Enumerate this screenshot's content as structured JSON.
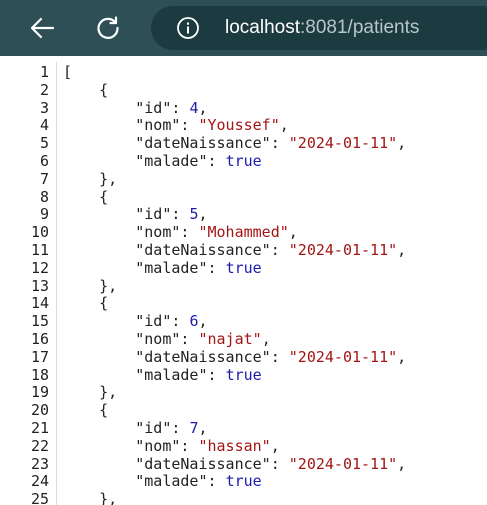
{
  "browser": {
    "back_icon": "arrow-left-icon",
    "reload_icon": "reload-icon",
    "info_icon": "info-icon",
    "url_host": "localhost",
    "url_rest": ":8081/patients"
  },
  "json_viewer": {
    "line_numbers": [
      "1",
      "2",
      "3",
      "4",
      "5",
      "6",
      "7",
      "8",
      "9",
      "10",
      "11",
      "12",
      "13",
      "14",
      "15",
      "16",
      "17",
      "18",
      "19",
      "20",
      "21",
      "22",
      "23",
      "24",
      "25"
    ],
    "open_bracket": "[",
    "open_brace": "{",
    "close_brace_comma": "},",
    "patients": [
      {
        "id": "4",
        "nom": "\"Youssef\"",
        "dateNaissance": "\"2024-01-11\"",
        "malade": "true"
      },
      {
        "id": "5",
        "nom": "\"Mohammed\"",
        "dateNaissance": "\"2024-01-11\"",
        "malade": "true"
      },
      {
        "id": "6",
        "nom": "\"najat\"",
        "dateNaissance": "\"2024-01-11\"",
        "malade": "true"
      },
      {
        "id": "7",
        "nom": "\"hassan\"",
        "dateNaissance": "\"2024-01-11\"",
        "malade": "true"
      }
    ],
    "keys": {
      "id": "\"id\"",
      "nom": "\"nom\"",
      "dateNaissance": "\"dateNaissance\"",
      "malade": "\"malade\""
    }
  }
}
